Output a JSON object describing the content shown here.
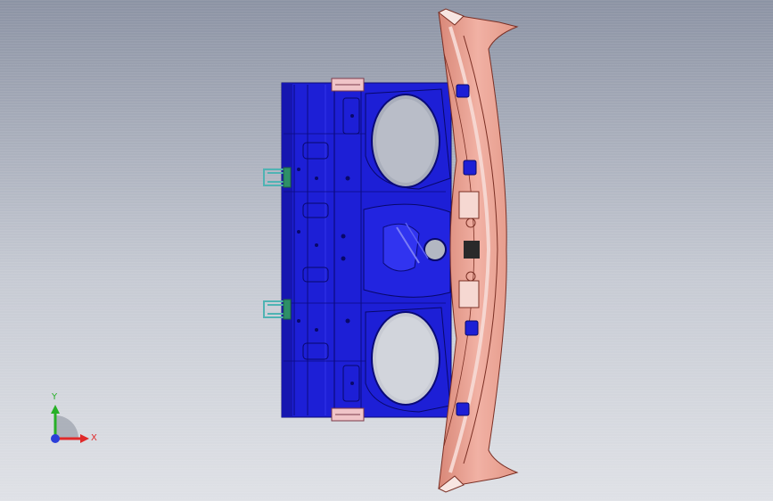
{
  "viewport": {
    "background_top": "#8c93a4",
    "background_bottom": "#dfe1e6"
  },
  "model": {
    "main_panel_color": "#1d1fd6",
    "rail_color": "#e9a093",
    "clip_color": "#4fb3b3"
  },
  "triad": {
    "x_label": "X",
    "y_label": "Y",
    "x_color": "#e02a2a",
    "y_color": "#27b027",
    "z_color": "#2a3ed9"
  }
}
